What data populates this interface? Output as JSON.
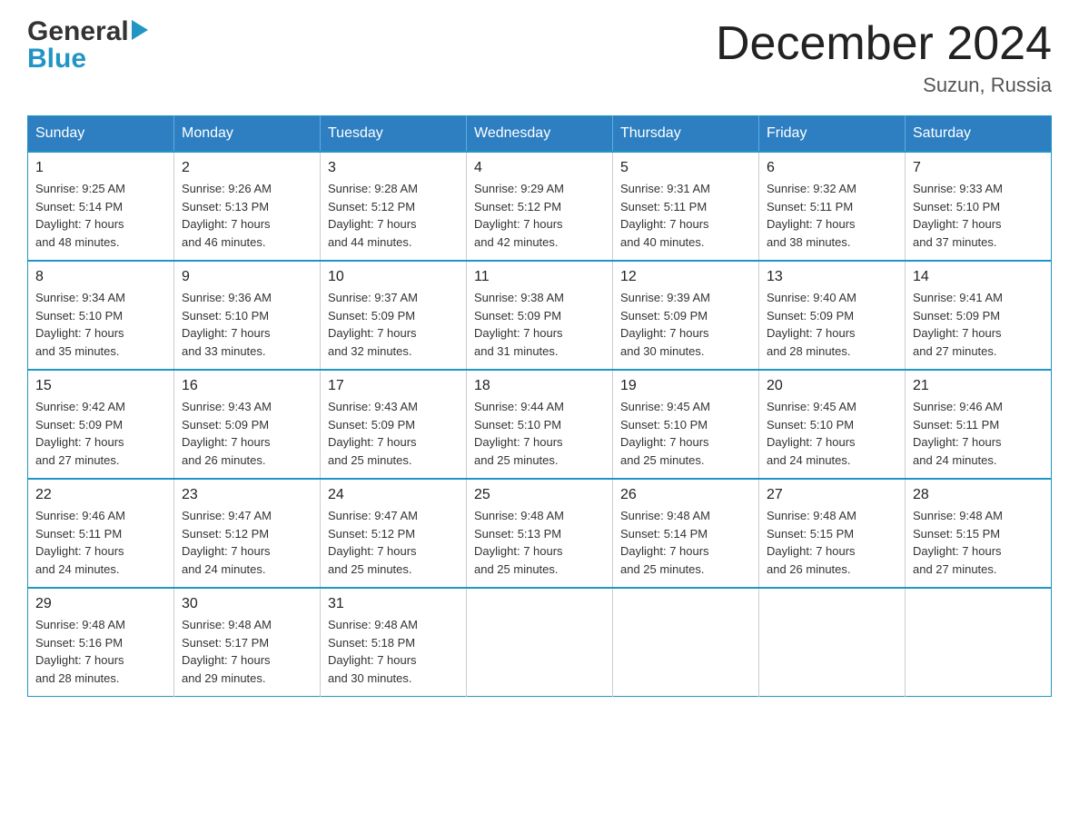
{
  "header": {
    "logo_top": "General",
    "logo_bottom": "Blue",
    "month_title": "December 2024",
    "location": "Suzun, Russia"
  },
  "calendar": {
    "days_of_week": [
      "Sunday",
      "Monday",
      "Tuesday",
      "Wednesday",
      "Thursday",
      "Friday",
      "Saturday"
    ],
    "weeks": [
      [
        {
          "day": "1",
          "sunrise": "Sunrise: 9:25 AM",
          "sunset": "Sunset: 5:14 PM",
          "daylight": "Daylight: 7 hours and 48 minutes."
        },
        {
          "day": "2",
          "sunrise": "Sunrise: 9:26 AM",
          "sunset": "Sunset: 5:13 PM",
          "daylight": "Daylight: 7 hours and 46 minutes."
        },
        {
          "day": "3",
          "sunrise": "Sunrise: 9:28 AM",
          "sunset": "Sunset: 5:12 PM",
          "daylight": "Daylight: 7 hours and 44 minutes."
        },
        {
          "day": "4",
          "sunrise": "Sunrise: 9:29 AM",
          "sunset": "Sunset: 5:12 PM",
          "daylight": "Daylight: 7 hours and 42 minutes."
        },
        {
          "day": "5",
          "sunrise": "Sunrise: 9:31 AM",
          "sunset": "Sunset: 5:11 PM",
          "daylight": "Daylight: 7 hours and 40 minutes."
        },
        {
          "day": "6",
          "sunrise": "Sunrise: 9:32 AM",
          "sunset": "Sunset: 5:11 PM",
          "daylight": "Daylight: 7 hours and 38 minutes."
        },
        {
          "day": "7",
          "sunrise": "Sunrise: 9:33 AM",
          "sunset": "Sunset: 5:10 PM",
          "daylight": "Daylight: 7 hours and 37 minutes."
        }
      ],
      [
        {
          "day": "8",
          "sunrise": "Sunrise: 9:34 AM",
          "sunset": "Sunset: 5:10 PM",
          "daylight": "Daylight: 7 hours and 35 minutes."
        },
        {
          "day": "9",
          "sunrise": "Sunrise: 9:36 AM",
          "sunset": "Sunset: 5:10 PM",
          "daylight": "Daylight: 7 hours and 33 minutes."
        },
        {
          "day": "10",
          "sunrise": "Sunrise: 9:37 AM",
          "sunset": "Sunset: 5:09 PM",
          "daylight": "Daylight: 7 hours and 32 minutes."
        },
        {
          "day": "11",
          "sunrise": "Sunrise: 9:38 AM",
          "sunset": "Sunset: 5:09 PM",
          "daylight": "Daylight: 7 hours and 31 minutes."
        },
        {
          "day": "12",
          "sunrise": "Sunrise: 9:39 AM",
          "sunset": "Sunset: 5:09 PM",
          "daylight": "Daylight: 7 hours and 30 minutes."
        },
        {
          "day": "13",
          "sunrise": "Sunrise: 9:40 AM",
          "sunset": "Sunset: 5:09 PM",
          "daylight": "Daylight: 7 hours and 28 minutes."
        },
        {
          "day": "14",
          "sunrise": "Sunrise: 9:41 AM",
          "sunset": "Sunset: 5:09 PM",
          "daylight": "Daylight: 7 hours and 27 minutes."
        }
      ],
      [
        {
          "day": "15",
          "sunrise": "Sunrise: 9:42 AM",
          "sunset": "Sunset: 5:09 PM",
          "daylight": "Daylight: 7 hours and 27 minutes."
        },
        {
          "day": "16",
          "sunrise": "Sunrise: 9:43 AM",
          "sunset": "Sunset: 5:09 PM",
          "daylight": "Daylight: 7 hours and 26 minutes."
        },
        {
          "day": "17",
          "sunrise": "Sunrise: 9:43 AM",
          "sunset": "Sunset: 5:09 PM",
          "daylight": "Daylight: 7 hours and 25 minutes."
        },
        {
          "day": "18",
          "sunrise": "Sunrise: 9:44 AM",
          "sunset": "Sunset: 5:10 PM",
          "daylight": "Daylight: 7 hours and 25 minutes."
        },
        {
          "day": "19",
          "sunrise": "Sunrise: 9:45 AM",
          "sunset": "Sunset: 5:10 PM",
          "daylight": "Daylight: 7 hours and 25 minutes."
        },
        {
          "day": "20",
          "sunrise": "Sunrise: 9:45 AM",
          "sunset": "Sunset: 5:10 PM",
          "daylight": "Daylight: 7 hours and 24 minutes."
        },
        {
          "day": "21",
          "sunrise": "Sunrise: 9:46 AM",
          "sunset": "Sunset: 5:11 PM",
          "daylight": "Daylight: 7 hours and 24 minutes."
        }
      ],
      [
        {
          "day": "22",
          "sunrise": "Sunrise: 9:46 AM",
          "sunset": "Sunset: 5:11 PM",
          "daylight": "Daylight: 7 hours and 24 minutes."
        },
        {
          "day": "23",
          "sunrise": "Sunrise: 9:47 AM",
          "sunset": "Sunset: 5:12 PM",
          "daylight": "Daylight: 7 hours and 24 minutes."
        },
        {
          "day": "24",
          "sunrise": "Sunrise: 9:47 AM",
          "sunset": "Sunset: 5:12 PM",
          "daylight": "Daylight: 7 hours and 25 minutes."
        },
        {
          "day": "25",
          "sunrise": "Sunrise: 9:48 AM",
          "sunset": "Sunset: 5:13 PM",
          "daylight": "Daylight: 7 hours and 25 minutes."
        },
        {
          "day": "26",
          "sunrise": "Sunrise: 9:48 AM",
          "sunset": "Sunset: 5:14 PM",
          "daylight": "Daylight: 7 hours and 25 minutes."
        },
        {
          "day": "27",
          "sunrise": "Sunrise: 9:48 AM",
          "sunset": "Sunset: 5:15 PM",
          "daylight": "Daylight: 7 hours and 26 minutes."
        },
        {
          "day": "28",
          "sunrise": "Sunrise: 9:48 AM",
          "sunset": "Sunset: 5:15 PM",
          "daylight": "Daylight: 7 hours and 27 minutes."
        }
      ],
      [
        {
          "day": "29",
          "sunrise": "Sunrise: 9:48 AM",
          "sunset": "Sunset: 5:16 PM",
          "daylight": "Daylight: 7 hours and 28 minutes."
        },
        {
          "day": "30",
          "sunrise": "Sunrise: 9:48 AM",
          "sunset": "Sunset: 5:17 PM",
          "daylight": "Daylight: 7 hours and 29 minutes."
        },
        {
          "day": "31",
          "sunrise": "Sunrise: 9:48 AM",
          "sunset": "Sunset: 5:18 PM",
          "daylight": "Daylight: 7 hours and 30 minutes."
        },
        null,
        null,
        null,
        null
      ]
    ]
  }
}
